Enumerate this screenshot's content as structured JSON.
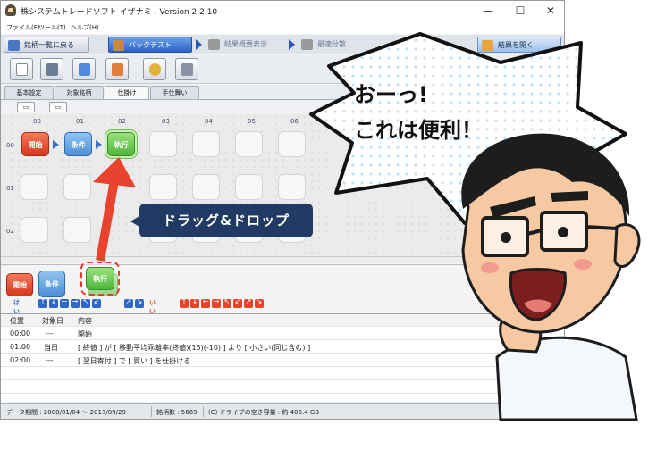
{
  "window": {
    "title": "株システムトレードソフト イザナミ - Version 2.2.10",
    "controls": {
      "minimize": "—",
      "maximize": "☐",
      "close": "✕"
    }
  },
  "menu": [
    "ファイル(F)",
    "ツール(T)",
    "ヘルプ(H)"
  ],
  "nav": {
    "back_label": "銘柄一覧に戻る",
    "backtest_label": "バックテスト",
    "summary_label": "結果概要表示",
    "optimize_label": "最適分散投資",
    "open_results_label": "結果を開く"
  },
  "tabs": [
    "基本設定",
    "対象銘柄",
    "仕掛け",
    "手仕舞い"
  ],
  "active_tab": "仕掛け",
  "grid": {
    "columns": [
      "00",
      "01",
      "02",
      "03",
      "04",
      "05",
      "06"
    ],
    "rows": [
      "00",
      "01",
      "02"
    ],
    "blocks": {
      "start": "開始",
      "condition": "条件",
      "execute": "執行"
    }
  },
  "palette": {
    "start": "開始",
    "condition": "条件",
    "execute": "執行",
    "yes_label": "はい",
    "no_label": "いいえ"
  },
  "log": {
    "headers": [
      "位置",
      "対象日",
      "内容"
    ],
    "rows": [
      [
        "00:00",
        "---",
        "開始"
      ],
      [
        "01:00",
        "当日",
        "[ 終値 ] が [ 移動平均乖離率(終値)(15)(-10) ] より [ 小さい(同じ含む) ]"
      ],
      [
        "02:00",
        "---",
        "[ 翌日寄付 ] で [ 買い ] を仕掛ける"
      ]
    ]
  },
  "status": {
    "period": "データ期間 : 2000/01/04 ～ 2017/09/29",
    "count": "銘柄数 : 5669",
    "disk": "(C) ドライブの空き容量 : 約 406.4 GB"
  },
  "callout": {
    "drag_drop": "ドラッグ&ドロップ"
  },
  "speech": {
    "line1": "おーっ!",
    "line2": "これは便利！"
  },
  "colors": {
    "start_block": "#e24a2c",
    "condition_block": "#5a9be0",
    "execute_block": "#5cc046",
    "accent_arrow": "#e8432e",
    "callout_bg": "#213a64"
  }
}
